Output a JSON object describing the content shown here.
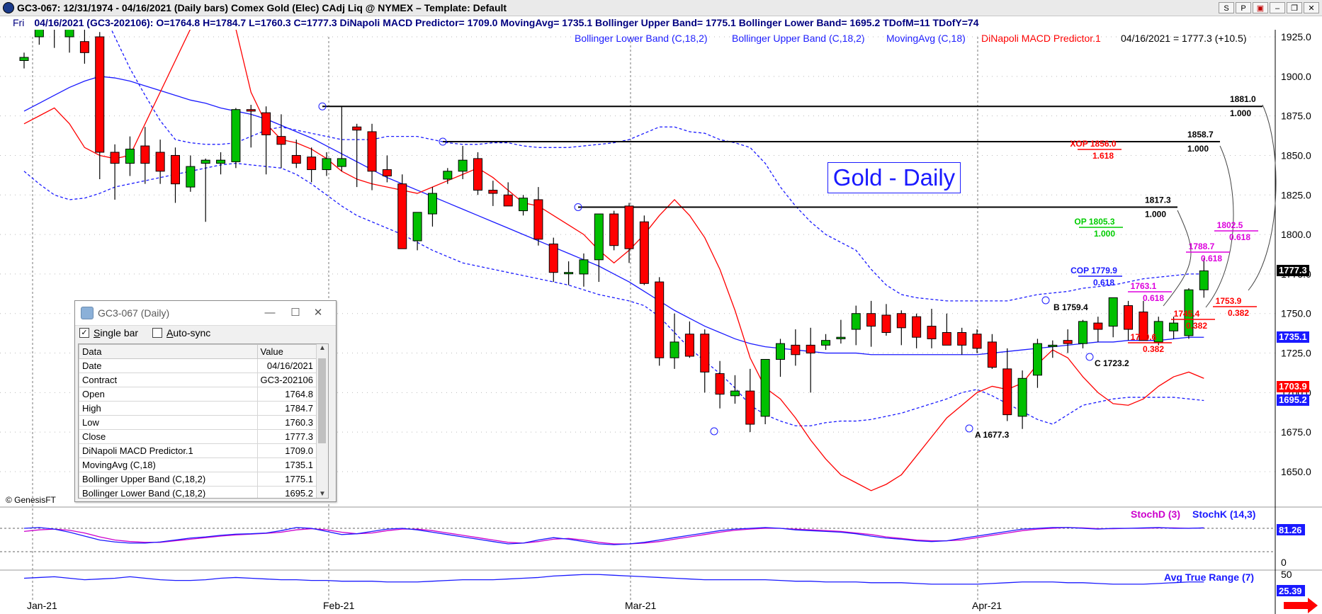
{
  "window": {
    "title": "GC3-067:  12/31/1974 - 04/16/2021  (Daily bars)   Comex Gold (Elec) CAdj Liq @ NYMEX  –  Template: Default",
    "buttons": [
      "S",
      "P",
      "▣",
      "–",
      "❐",
      "✕"
    ]
  },
  "infobar": {
    "day": "Fri",
    "text": "04/16/2021 (GC3-202106):  O=1764.8  H=1784.7  L=1760.3  C=1777.3  DiNapoli MACD Predictor= 1709.0  MovingAvg= 1735.1  Bollinger Upper Band= 1775.1  Bollinger Lower Band= 1695.2  TDofM=11  TDofY=74"
  },
  "legend": {
    "items": [
      {
        "label": "Bollinger Lower Band (C,18,2)",
        "color": "#1a1aff"
      },
      {
        "label": "Bollinger Upper Band (C,18,2)",
        "color": "#1a1aff"
      },
      {
        "label": "MovingAvg (C,18)",
        "color": "#1a1aff"
      },
      {
        "label": "DiNapoli MACD Predictor.1",
        "color": "#ff0000"
      }
    ],
    "last_close": "04/16/2021 = 1777.3 (+10.5)"
  },
  "annotation_title": "Gold - Daily",
  "watermark": "© GenesisFT",
  "colors": {
    "up": "#00c000",
    "down": "#ff0000",
    "bands": "#1a1aff",
    "macd": "#ff0000",
    "stoch_k": "#1a1aff",
    "stoch_d": "#cc00cc"
  },
  "price_axis": {
    "ticks": [
      "1925.0",
      "1900.0",
      "1875.0",
      "1850.0",
      "1825.0",
      "1800.0",
      "1775.0",
      "1750.0",
      "1725.0",
      "1700.0",
      "1675.0",
      "1650.0"
    ]
  },
  "price_tags": [
    {
      "text": "1777.3",
      "price": 1777.3,
      "bg": "#000000"
    },
    {
      "text": "1735.1",
      "price": 1735.1,
      "bg": "#1a1aff"
    },
    {
      "text": "1703.9",
      "price": 1703.9,
      "bg": "#ff0000"
    },
    {
      "text": "1695.2",
      "price": 1695.2,
      "bg": "#1a1aff"
    }
  ],
  "stoch": {
    "label_d": "StochD (3)",
    "label_k": "StochK (14,3)",
    "value": "81.26",
    "axis_zero": "0",
    "axis_top": "50"
  },
  "atr": {
    "label": "Avg True Range (7)",
    "value": "25.39"
  },
  "time_axis": [
    "Jan-21",
    "Feb-21",
    "Mar-21",
    "Apr-21"
  ],
  "chart_data": {
    "type": "candlestick",
    "title": "Gold - Daily",
    "ylim": [
      1635,
      1935
    ],
    "candles": [
      [
        1910,
        1915,
        1905,
        1912
      ],
      [
        1925,
        1945,
        1920,
        1940
      ],
      [
        1940,
        1945,
        1918,
        1930
      ],
      [
        1925,
        1932,
        1915,
        1930
      ],
      [
        1922,
        1930,
        1908,
        1915
      ],
      [
        1925,
        1928,
        1835,
        1852
      ],
      [
        1852,
        1857,
        1822,
        1845
      ],
      [
        1845,
        1862,
        1837,
        1854
      ],
      [
        1856,
        1868,
        1832,
        1845
      ],
      [
        1852,
        1860,
        1832,
        1840
      ],
      [
        1850,
        1855,
        1820,
        1832
      ],
      [
        1830,
        1850,
        1827,
        1843
      ],
      [
        1845,
        1848,
        1808,
        1847
      ],
      [
        1845,
        1852,
        1838,
        1847
      ],
      [
        1846,
        1880,
        1842,
        1879
      ],
      [
        1879,
        1882,
        1855,
        1878
      ],
      [
        1877,
        1881,
        1838,
        1863
      ],
      [
        1862,
        1876,
        1842,
        1857
      ],
      [
        1850,
        1860,
        1842,
        1845
      ],
      [
        1849,
        1855,
        1833,
        1841
      ],
      [
        1841,
        1852,
        1837,
        1848
      ],
      [
        1843,
        1881,
        1840,
        1848
      ],
      [
        1868,
        1870,
        1830,
        1866
      ],
      [
        1865,
        1870,
        1828,
        1840
      ],
      [
        1841,
        1850,
        1833,
        1837
      ],
      [
        1832,
        1838,
        1792,
        1791
      ],
      [
        1796,
        1806,
        1790,
        1814
      ],
      [
        1813,
        1830,
        1805,
        1826
      ],
      [
        1835,
        1842,
        1832,
        1840
      ],
      [
        1840,
        1856,
        1835,
        1847
      ],
      [
        1848,
        1852,
        1825,
        1828
      ],
      [
        1828,
        1834,
        1818,
        1826
      ],
      [
        1825,
        1833,
        1818,
        1818
      ],
      [
        1815,
        1825,
        1812,
        1823
      ],
      [
        1822,
        1830,
        1793,
        1797
      ],
      [
        1794,
        1798,
        1770,
        1776
      ],
      [
        1776,
        1783,
        1768,
        1776
      ],
      [
        1775,
        1788,
        1767,
        1784
      ],
      [
        1784,
        1790,
        1770,
        1813
      ],
      [
        1813,
        1815,
        1790,
        1793
      ],
      [
        1818,
        1820,
        1782,
        1791
      ],
      [
        1808,
        1812,
        1768,
        1769
      ],
      [
        1770,
        1773,
        1717,
        1722
      ],
      [
        1722,
        1750,
        1715,
        1732
      ],
      [
        1737,
        1745,
        1722,
        1723
      ],
      [
        1737,
        1740,
        1700,
        1713
      ],
      [
        1712,
        1720,
        1690,
        1699
      ],
      [
        1698,
        1711,
        1693,
        1701
      ],
      [
        1701,
        1715,
        1675,
        1680
      ],
      [
        1685,
        1721,
        1680,
        1721
      ],
      [
        1721,
        1734,
        1710,
        1731
      ],
      [
        1730,
        1740,
        1717,
        1724
      ],
      [
        1730,
        1741,
        1700,
        1725
      ],
      [
        1730,
        1737,
        1727,
        1733
      ],
      [
        1734,
        1746,
        1731,
        1735
      ],
      [
        1740,
        1755,
        1730,
        1750
      ],
      [
        1750,
        1758,
        1729,
        1742
      ],
      [
        1749,
        1756,
        1736,
        1738
      ],
      [
        1750,
        1752,
        1730,
        1741
      ],
      [
        1748,
        1750,
        1728,
        1735
      ],
      [
        1742,
        1753,
        1728,
        1734
      ],
      [
        1738,
        1750,
        1730,
        1730
      ],
      [
        1738,
        1741,
        1724,
        1730
      ],
      [
        1737,
        1740,
        1725,
        1728
      ],
      [
        1732,
        1737,
        1715,
        1716
      ],
      [
        1715,
        1728,
        1682,
        1686
      ],
      [
        1685,
        1714,
        1677,
        1709
      ],
      [
        1711,
        1734,
        1703,
        1731
      ],
      [
        1730,
        1733,
        1722,
        1730
      ],
      [
        1733,
        1740,
        1725,
        1731
      ],
      [
        1731,
        1746,
        1728,
        1745
      ],
      [
        1744,
        1748,
        1732,
        1740
      ],
      [
        1742,
        1754,
        1735,
        1760
      ],
      [
        1755,
        1758,
        1733,
        1740
      ],
      [
        1751,
        1758,
        1737,
        1733
      ],
      [
        1732,
        1748,
        1730,
        1745
      ],
      [
        1739,
        1748,
        1734,
        1744
      ],
      [
        1736,
        1766,
        1734,
        1765
      ],
      [
        1765,
        1785,
        1760,
        1777
      ]
    ],
    "bollinger_upper": [
      1965,
      1965,
      1965,
      1965,
      1960,
      1945,
      1925,
      1905,
      1888,
      1872,
      1860,
      1858,
      1857,
      1857,
      1858,
      1862,
      1866,
      1868,
      1866,
      1864,
      1862,
      1860,
      1860,
      1860,
      1862,
      1862,
      1862,
      1860,
      1858,
      1857,
      1857,
      1858,
      1858,
      1856,
      1855,
      1855,
      1855,
      1856,
      1857,
      1858,
      1860,
      1864,
      1868,
      1868,
      1865,
      1864,
      1860,
      1858,
      1855,
      1845,
      1830,
      1818,
      1808,
      1800,
      1795,
      1790,
      1778,
      1768,
      1762,
      1760,
      1759,
      1758,
      1758,
      1758,
      1758,
      1758,
      1760,
      1762,
      1763,
      1764,
      1766,
      1767,
      1768,
      1770,
      1772,
      1773,
      1774,
      1775,
      1775
    ],
    "bollinger_lower": [
      1840,
      1832,
      1825,
      1822,
      1823,
      1826,
      1830,
      1832,
      1834,
      1836,
      1838,
      1840,
      1842,
      1844,
      1845,
      1844,
      1843,
      1842,
      1838,
      1832,
      1825,
      1818,
      1812,
      1808,
      1804,
      1800,
      1795,
      1790,
      1786,
      1782,
      1780,
      1778,
      1776,
      1774,
      1772,
      1770,
      1768,
      1765,
      1762,
      1760,
      1758,
      1755,
      1748,
      1738,
      1728,
      1720,
      1712,
      1703,
      1692,
      1686,
      1682,
      1679,
      1679,
      1681,
      1682,
      1682,
      1683,
      1685,
      1687,
      1690,
      1693,
      1696,
      1700,
      1702,
      1698,
      1693,
      1688,
      1683,
      1680,
      1686,
      1692,
      1694,
      1696,
      1697,
      1697,
      1697,
      1697,
      1696,
      1695
    ],
    "moving_avg": [
      1878,
      1883,
      1888,
      1893,
      1897,
      1900,
      1899,
      1897,
      1894,
      1891,
      1888,
      1885,
      1883,
      1880,
      1878,
      1876,
      1873,
      1869,
      1865,
      1861,
      1856,
      1851,
      1846,
      1841,
      1836,
      1832,
      1828,
      1824,
      1820,
      1816,
      1812,
      1808,
      1804,
      1800,
      1796,
      1792,
      1788,
      1784,
      1780,
      1775,
      1770,
      1764,
      1758,
      1752,
      1747,
      1742,
      1738,
      1734,
      1731,
      1729,
      1728,
      1727,
      1726,
      1725,
      1725,
      1725,
      1724,
      1724,
      1724,
      1724,
      1724,
      1724,
      1724,
      1724,
      1725,
      1726,
      1727,
      1728,
      1729,
      1730,
      1731,
      1732,
      1732,
      1733,
      1733,
      1733,
      1734,
      1735,
      1735
    ],
    "macd_predictor": [
      1870,
      1875,
      1880,
      1870,
      1855,
      1850,
      1848,
      1850,
      1870,
      1890,
      1910,
      1930,
      1960,
      1970,
      1930,
      1890,
      1870,
      1860,
      1858,
      1854,
      1848,
      1840,
      1835,
      1832,
      1830,
      1828,
      1826,
      1830,
      1834,
      1838,
      1842,
      1836,
      1828,
      1820,
      1818,
      1812,
      1806,
      1800,
      1790,
      1782,
      1790,
      1800,
      1812,
      1822,
      1812,
      1798,
      1778,
      1752,
      1722,
      1703,
      1696,
      1684,
      1670,
      1658,
      1648,
      1643,
      1638,
      1642,
      1648,
      1660,
      1672,
      1684,
      1692,
      1700,
      1704,
      1702,
      1706,
      1718,
      1727,
      1722,
      1710,
      1700,
      1693,
      1692,
      1696,
      1704,
      1710,
      1713,
      1709
    ],
    "horizontal_levels": [
      {
        "price": 1881.0,
        "label": "1881.0",
        "ratio": "1.000"
      },
      {
        "price": 1858.7,
        "label": "1858.7",
        "ratio": "1.000"
      },
      {
        "price": 1817.3,
        "label": "1817.3",
        "ratio": "1.000"
      }
    ],
    "fib_labels": [
      {
        "text": "XOP 1856.0",
        "ratio": "1.618",
        "color": "#ff0000"
      },
      {
        "text": "OP 1805.3",
        "ratio": "1.000",
        "color": "#00cc00"
      },
      {
        "text": "COP 1779.9",
        "ratio": "0.618",
        "color": "#1a1aff"
      },
      {
        "text": "1802.5",
        "ratio": "0.618",
        "color": "#dd00dd"
      },
      {
        "text": "1788.7",
        "ratio": "0.618",
        "color": "#dd00dd"
      },
      {
        "text": "1763.1",
        "ratio": "0.618",
        "color": "#dd00dd"
      },
      {
        "text": "1753.9",
        "ratio": "0.382",
        "color": "#ff0000"
      },
      {
        "text": "1745.4",
        "ratio": "0.382",
        "color": "#ff0000"
      },
      {
        "text": "1729.6",
        "ratio": "0.382",
        "color": "#ff0000"
      }
    ],
    "point_labels": [
      "A 1677.3",
      "B 1759.4",
      "C 1723.2"
    ],
    "stoch_k": [
      80,
      82,
      78,
      70,
      60,
      50,
      45,
      42,
      42,
      45,
      50,
      55,
      58,
      62,
      65,
      66,
      68,
      74,
      82,
      80,
      72,
      64,
      66,
      72,
      78,
      80,
      76,
      70,
      64,
      58,
      52,
      46,
      40,
      42,
      50,
      56,
      52,
      46,
      40,
      38,
      40,
      44,
      50,
      56,
      62,
      68,
      74,
      78,
      80,
      82,
      80,
      76,
      74,
      72,
      70,
      66,
      60,
      55,
      52,
      48,
      46,
      48,
      54,
      60,
      66,
      72,
      78,
      80,
      82,
      82,
      80,
      78,
      80,
      80,
      81,
      82,
      80,
      80,
      81
    ],
    "stoch_d": [
      72,
      76,
      78,
      75,
      68,
      58,
      50,
      46,
      44,
      44,
      48,
      52,
      56,
      60,
      63,
      65,
      67,
      70,
      76,
      79,
      76,
      70,
      66,
      68,
      74,
      78,
      78,
      74,
      68,
      62,
      56,
      50,
      44,
      42,
      46,
      52,
      54,
      50,
      44,
      40,
      40,
      42,
      46,
      52,
      58,
      64,
      70,
      75,
      78,
      80,
      80,
      78,
      76,
      74,
      72,
      68,
      64,
      58,
      54,
      50,
      48,
      48,
      50,
      56,
      62,
      68,
      74,
      78,
      80,
      82,
      81,
      79,
      79,
      80,
      80,
      81,
      81,
      80,
      81
    ],
    "atr": [
      30,
      31,
      32,
      30,
      28,
      29,
      30,
      32,
      30,
      28,
      27,
      27,
      28,
      30,
      31,
      30,
      29,
      28,
      28,
      27,
      27,
      26,
      26,
      26,
      25,
      25,
      25,
      26,
      27,
      28,
      28,
      28,
      29,
      30,
      31,
      33,
      34,
      35,
      35,
      34,
      33,
      32,
      31,
      30,
      29,
      28,
      28,
      28,
      28,
      28,
      27,
      26,
      26,
      25,
      25,
      25,
      24,
      24,
      24,
      23,
      22,
      22,
      22,
      22,
      23,
      24,
      25,
      25,
      25,
      24,
      24,
      23,
      22,
      22,
      22,
      23,
      24,
      25,
      25
    ]
  }
}
